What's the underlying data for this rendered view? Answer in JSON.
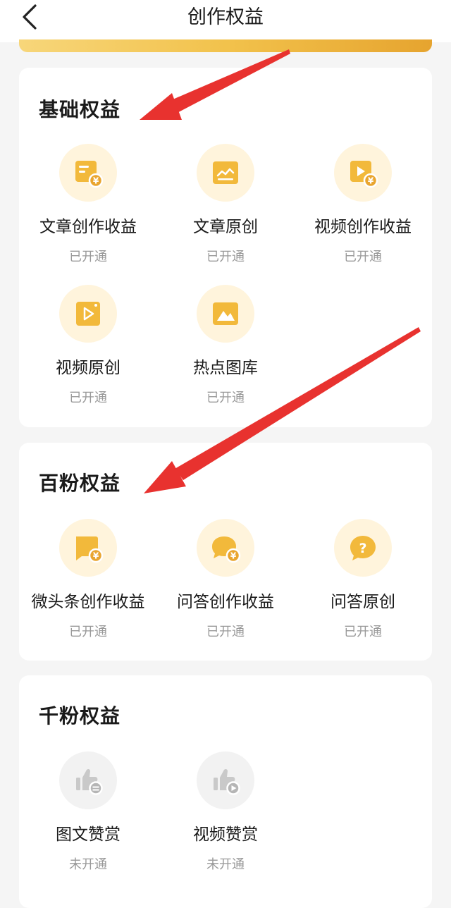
{
  "header": {
    "title": "创作权益",
    "back_icon": "back-arrow-icon"
  },
  "colors": {
    "gold": "#f2b93b",
    "gold_light": "#fff4dc",
    "gray_icon": "#c9c9c9",
    "annotation_arrow": "#e8322f"
  },
  "sections": [
    {
      "title": "基础权益",
      "items": [
        {
          "label": "文章创作收益",
          "status": "已开通",
          "icon": "article-income-icon"
        },
        {
          "label": "文章原创",
          "status": "已开通",
          "icon": "article-original-icon"
        },
        {
          "label": "视频创作收益",
          "status": "已开通",
          "icon": "video-income-icon"
        },
        {
          "label": "视频原创",
          "status": "已开通",
          "icon": "video-original-icon"
        },
        {
          "label": "热点图库",
          "status": "已开通",
          "icon": "hot-gallery-icon"
        }
      ]
    },
    {
      "title": "百粉权益",
      "items": [
        {
          "label": "微头条创作收益",
          "status": "已开通",
          "icon": "micro-post-income-icon"
        },
        {
          "label": "问答创作收益",
          "status": "已开通",
          "icon": "qa-income-icon"
        },
        {
          "label": "问答原创",
          "status": "已开通",
          "icon": "qa-original-icon"
        }
      ]
    },
    {
      "title": "千粉权益",
      "items": [
        {
          "label": "图文赞赏",
          "status": "未开通",
          "icon": "article-tip-icon"
        },
        {
          "label": "视频赞赏",
          "status": "未开通",
          "icon": "video-tip-icon"
        }
      ]
    }
  ]
}
